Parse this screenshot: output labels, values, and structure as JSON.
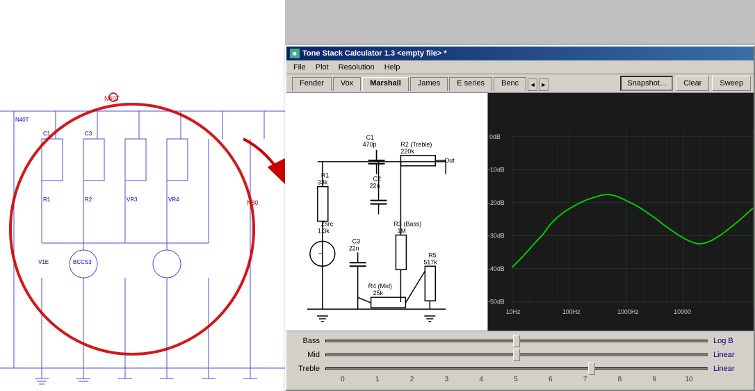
{
  "window": {
    "title": "Tone Stack Calculator 1.3 <empty file> *",
    "icon": "TSC"
  },
  "menu": {
    "items": [
      "File",
      "Plot",
      "Resolution",
      "Help"
    ]
  },
  "toolbar": {
    "snapshot_label": "Snapshot...",
    "clear_label": "Clear",
    "sweep_label": "Sweep"
  },
  "tabs": {
    "items": [
      "Fender",
      "Vox",
      "Marshall",
      "James",
      "E series",
      "Benc"
    ],
    "active": "Marshall",
    "nav_prev": "◄",
    "nav_next": "►"
  },
  "circuit": {
    "components": {
      "C1": "C1\n470p",
      "R2": "R2 (Treble)\n220k",
      "R1": "R1\n33k",
      "C2": "C2\n22n",
      "Zsrc": "Zsrc\n1.3k",
      "R3": "R3 (Bass)\n1M",
      "C3": "C3\n22n",
      "R5": "R5\n517k",
      "R4": "R4 (Mid)\n25k",
      "Out": "Out"
    }
  },
  "controls": {
    "sliders": [
      {
        "label": "Bass",
        "value": 50,
        "mode": "Log B"
      },
      {
        "label": "Mid",
        "value": 50,
        "mode": "Linear"
      },
      {
        "label": "Treble",
        "value": 70,
        "mode": "Linear"
      }
    ],
    "scale": [
      "0",
      "1",
      "2",
      "3",
      "4",
      "5",
      "6",
      "7",
      "8",
      "9",
      "10"
    ]
  },
  "graph": {
    "y_labels": [
      "0dB",
      "-10dB",
      "-20dB",
      "-30dB",
      "-40dB",
      "-50dB"
    ],
    "x_labels": [
      "10Hz",
      "100Hz",
      "1000Hz",
      "10000"
    ],
    "grid_color": "#2a4a2a",
    "line_color": "#00cc00"
  },
  "colors": {
    "window_bg": "#d4d0c8",
    "title_bar_start": "#0a246a",
    "title_bar_end": "#3a6ea5",
    "graph_bg": "#1a1a1a",
    "graph_grid": "#2a4a2a",
    "graph_line": "#00cc00"
  }
}
